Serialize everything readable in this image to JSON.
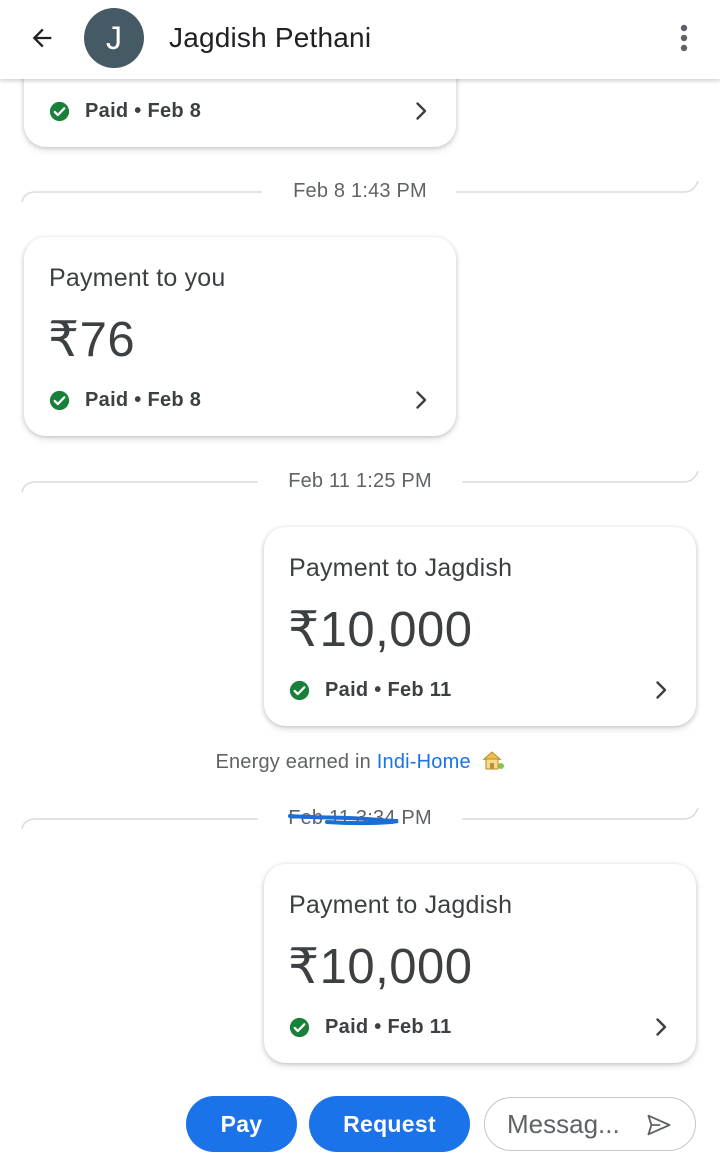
{
  "header": {
    "back_icon": "arrow-back-icon",
    "avatar_letter": "J",
    "avatar_color": "#455a64",
    "contact_name": "Jagdish Pethani",
    "more_icon": "more-vert-icon"
  },
  "colors": {
    "accent": "#1a73e8",
    "paid_green": "#188038",
    "text": "#3c4043",
    "secondary_text": "#5f6368"
  },
  "messages": [
    {
      "status": "Paid • Feb 8"
    },
    {
      "date": "Feb 8 1:43 PM",
      "title": "Payment to you",
      "amount": "₹76",
      "status": "Paid • Feb 8"
    },
    {
      "date": "Feb 11 1:25 PM",
      "title": "Payment to Jagdish",
      "amount": "₹10,000",
      "status": "Paid • Feb 11"
    },
    {
      "date": "Feb 11 3:34 PM",
      "title": "Payment to Jagdish",
      "amount": "₹10,000",
      "status": "Paid • Feb 11"
    }
  ],
  "energy": {
    "prefix": "Energy earned in",
    "link": "Indi-Home"
  },
  "actions": {
    "pay_label": "Pay",
    "request_label": "Request",
    "message_placeholder": "Messag...",
    "send_icon": "send-icon"
  }
}
